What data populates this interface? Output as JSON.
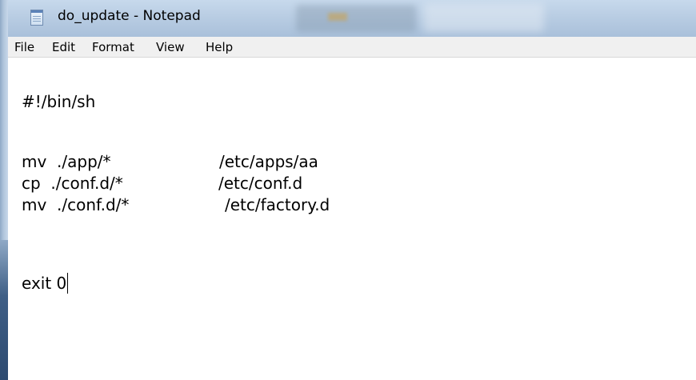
{
  "window": {
    "title": "do_update - Notepad",
    "icon": "notepad-icon"
  },
  "menu": {
    "items": [
      "File",
      "Edit",
      "Format",
      "View",
      "Help"
    ]
  },
  "editor": {
    "lines": [
      {
        "cmd": "#!/bin/sh",
        "target": ""
      },
      {
        "cmd": "",
        "target": ""
      },
      {
        "cmd": "mv  ./app/*",
        "target": "/etc/apps/aa"
      },
      {
        "cmd": "cp  ./conf.d/*",
        "target": "/etc/conf.d"
      },
      {
        "cmd": "mv  ./conf.d/*",
        "target": "/etc/factory.d"
      },
      {
        "cmd": "",
        "target": ""
      },
      {
        "cmd": "exit 0",
        "target": ""
      }
    ]
  },
  "colors": {
    "titlebar": "#b9cde3",
    "menubar": "#f0f0f0",
    "editor_bg": "#ffffff"
  }
}
